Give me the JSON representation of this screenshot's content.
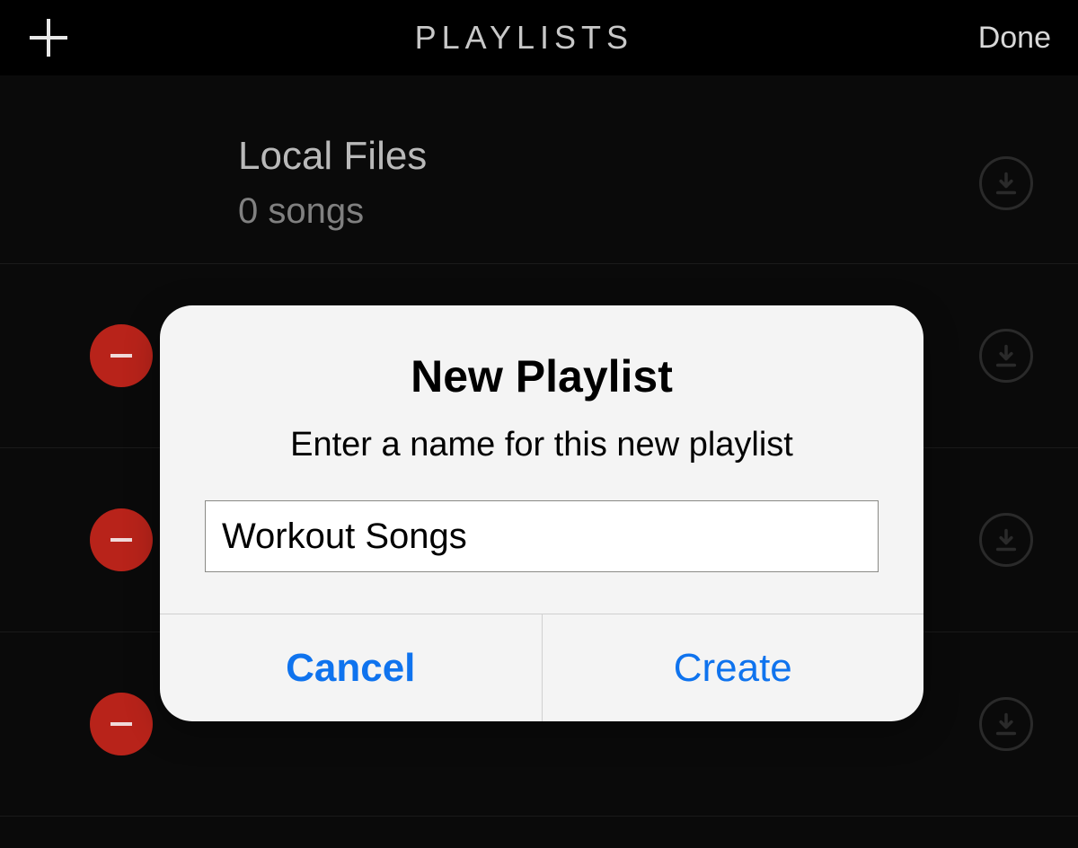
{
  "header": {
    "title": "PLAYLISTS",
    "done_label": "Done"
  },
  "playlists": {
    "local_files": {
      "title": "Local Files",
      "subtitle": "0 songs"
    }
  },
  "modal": {
    "title": "New Playlist",
    "subtitle": "Enter a name for this new playlist",
    "input_value": "Workout Songs",
    "cancel_label": "Cancel",
    "create_label": "Create"
  },
  "colors": {
    "delete_badge": "#b8231a",
    "link_blue": "#0f73ee"
  }
}
